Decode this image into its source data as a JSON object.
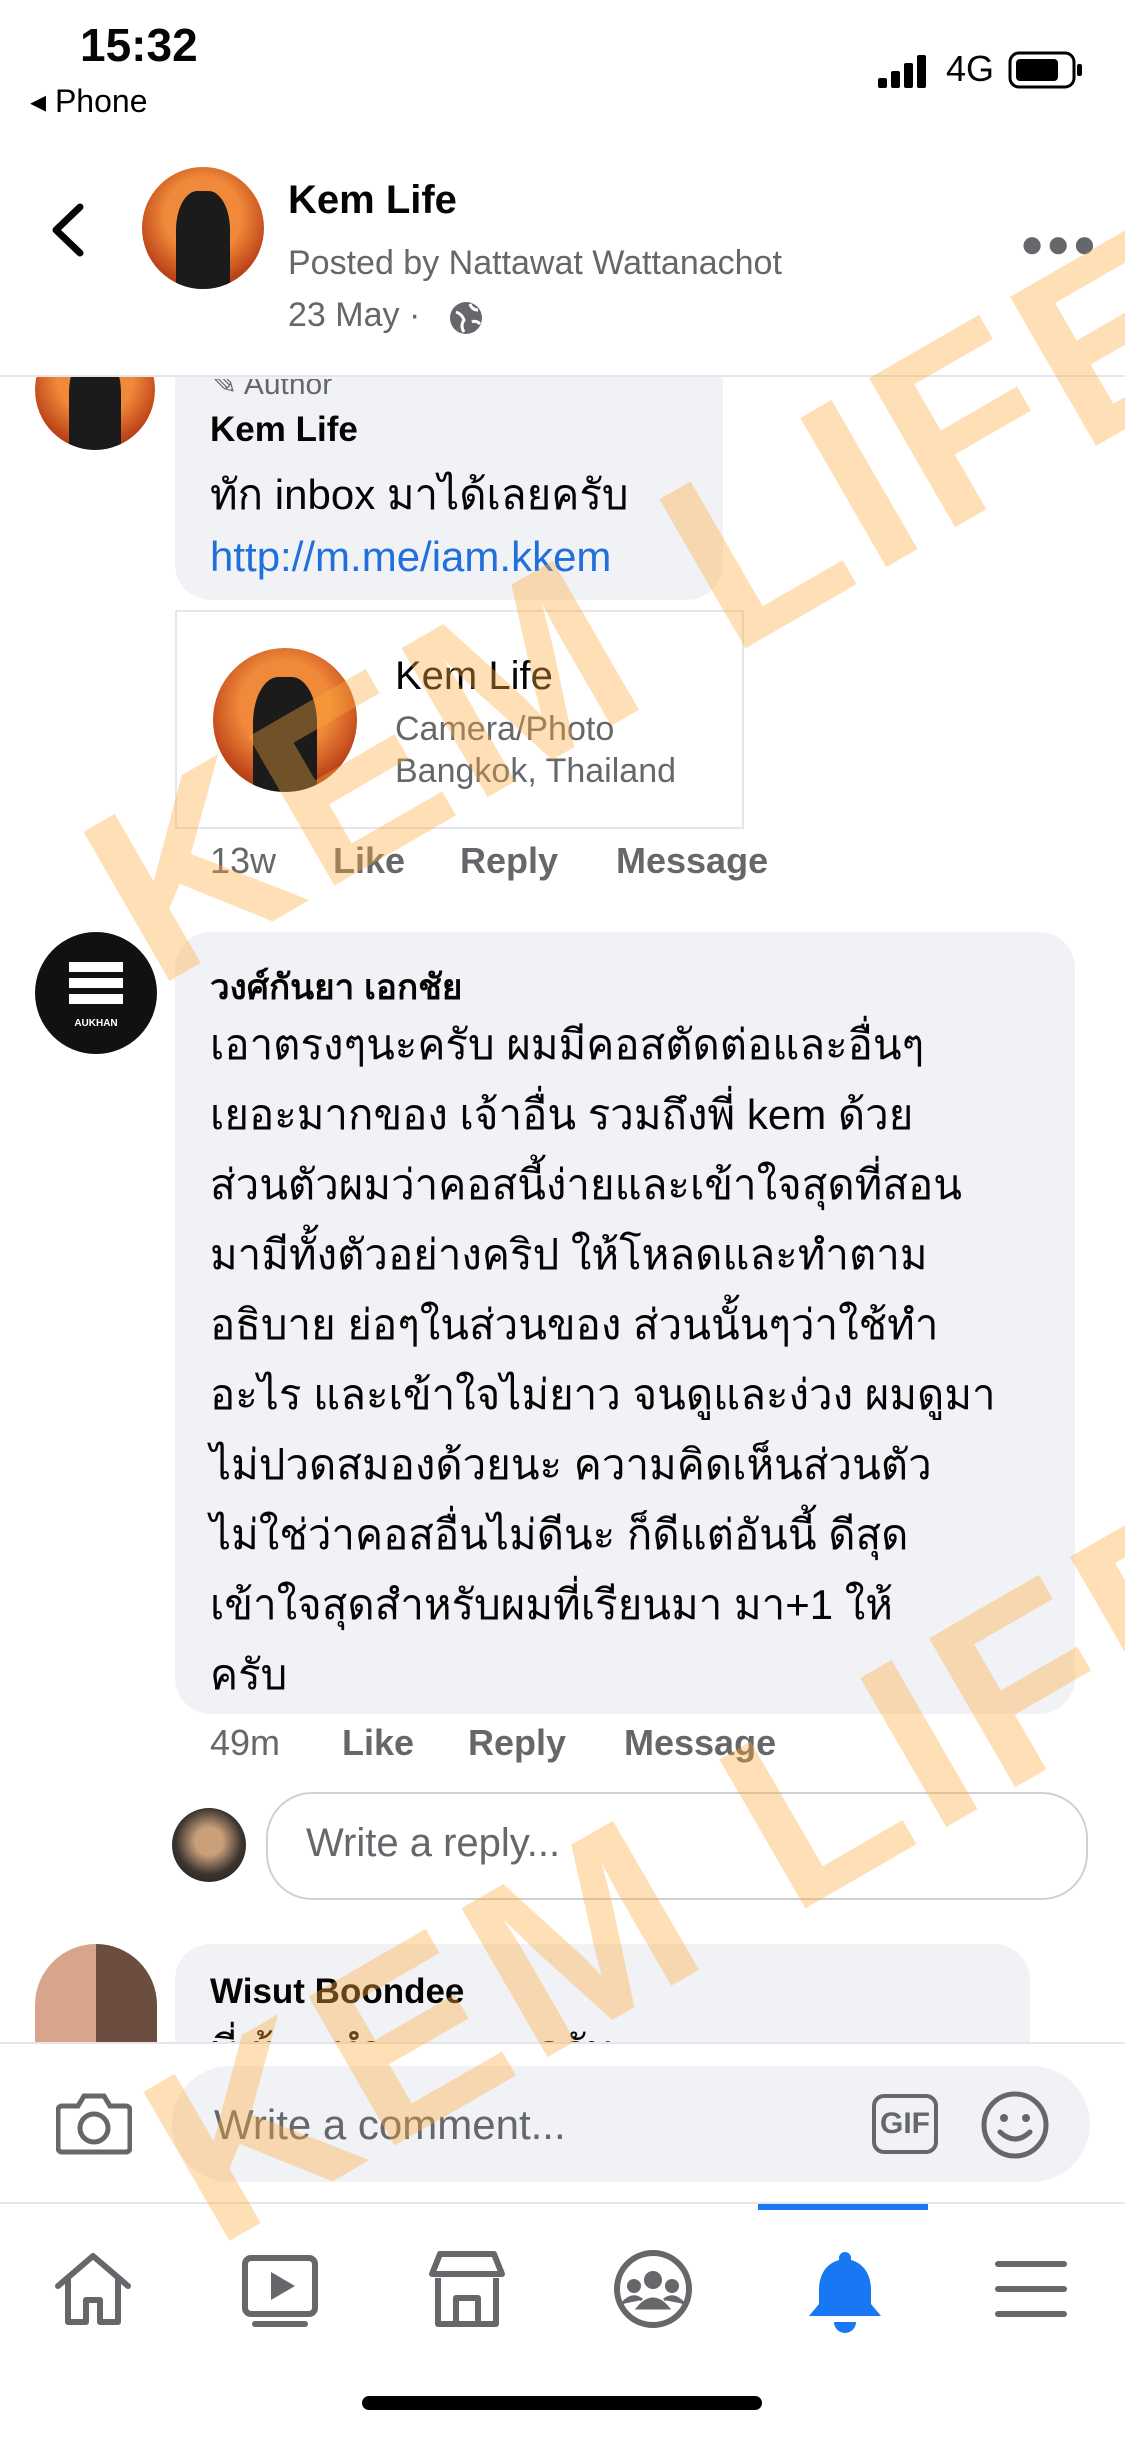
{
  "status_bar": {
    "time": "15:32",
    "back_label": "◂ Phone",
    "network": "4G"
  },
  "header": {
    "title": "Kem Life",
    "posted_by": "Posted by Nattawat Wattanachot",
    "date": "23 May ·"
  },
  "comment1": {
    "author_badge": "Author",
    "name": "Kem Life",
    "text": "ทัก inbox มาได้เลยครับ",
    "link": "http://m.me/iam.kkem",
    "card": {
      "name": "Kem Life",
      "category": "Camera/Photo",
      "location": "Bangkok, Thailand"
    },
    "time": "13w",
    "like": "Like",
    "reply": "Reply",
    "message": "Message"
  },
  "comment2": {
    "name": "วงศ์กันยา เอกชัย",
    "avatar_text": "AUKHAN",
    "lines": [
      "เอาตรงๆนะครับ ผมมีคอสตัดต่อและอื่นๆ",
      "เยอะมากของ เจ้าอื่น รวมถึงพี่ kem ด้วย",
      "ส่วนตัวผมว่าคอสนี้ง่ายและเข้าใจสุดที่สอน",
      "มามีทั้งตัวอย่างคริป ให้โหลดและทำตาม",
      "อธิบาย ย่อๆในส่วนของ ส่วนนั้นๆว่าใช้ทำ",
      "อะไร และเข้าใจไม่ยาว จนดูและง่วง ผมดูมา",
      "ไม่ปวดสมองด้วยนะ  ความคิดเห็นส่วนตัว",
      "ไม่ใช่ว่าคอสอื่นไม่ดีนะ ก็ดีแต่อันนี้ ดีสุด",
      "เข้าใจสุดสำหรับผมที่เรียนมา   มา+1 ให้",
      "ครับ"
    ],
    "time": "49m",
    "like": "Like",
    "reply": "Reply",
    "message": "Message"
  },
  "reply_box": {
    "placeholder": "Write a reply..."
  },
  "comment3": {
    "name": "Wisut Boondee",
    "text_partial": "พี่ ผู้ ... ทำ ... ... ... ครับ"
  },
  "comment_bar": {
    "placeholder": "Write a comment...",
    "gif_label": "GIF"
  },
  "tabs": [
    {
      "icon": "home-icon"
    },
    {
      "icon": "watch-icon"
    },
    {
      "icon": "marketplace-icon"
    },
    {
      "icon": "groups-icon"
    },
    {
      "icon": "notifications-icon",
      "active": true
    },
    {
      "icon": "menu-icon"
    }
  ],
  "watermark": "KEM LIFE",
  "colors": {
    "accent": "#1877f2",
    "link": "#216fdb",
    "bubble": "#f0f2f5",
    "watermark": "#ffaa3c"
  }
}
